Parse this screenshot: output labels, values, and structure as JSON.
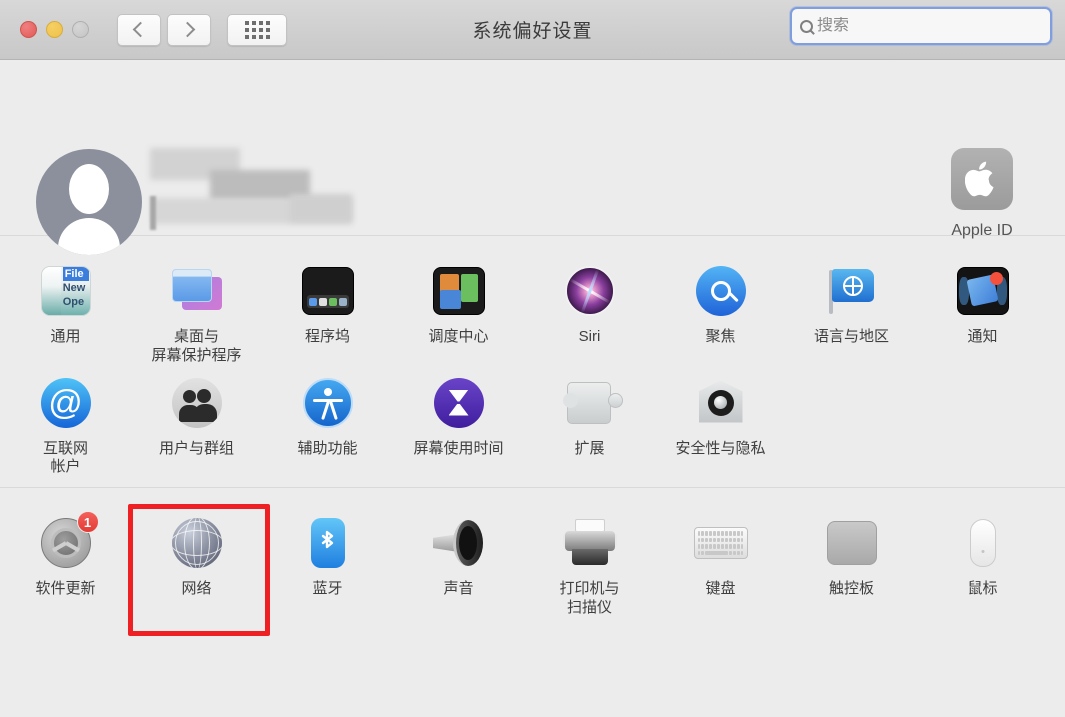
{
  "window": {
    "title": "系统偏好设置",
    "traffic_lights": [
      "close",
      "minimize",
      "zoom"
    ],
    "nav": {
      "back": "back-arrow",
      "forward": "forward-arrow",
      "grid": "show-all-grid"
    }
  },
  "search": {
    "placeholder": "搜索",
    "value": "",
    "icon": "search-icon",
    "focused": true
  },
  "account": {
    "avatar": "default-user-avatar",
    "name_redacted": true,
    "apple_id": {
      "label": "Apple ID",
      "icon": "apple-logo-icon"
    }
  },
  "sections": [
    {
      "id": "personal",
      "rows": [
        [
          {
            "label": "通用",
            "icon": "general-icon"
          },
          {
            "label": "桌面与\n屏幕保护程序",
            "icon": "desktop-screensaver-icon"
          },
          {
            "label": "程序坞",
            "icon": "dock-icon"
          },
          {
            "label": "调度中心",
            "icon": "mission-control-icon"
          },
          {
            "label": "Siri",
            "icon": "siri-icon"
          },
          {
            "label": "聚焦",
            "icon": "spotlight-icon"
          },
          {
            "label": "语言与地区",
            "icon": "language-region-icon"
          },
          {
            "label": "通知",
            "icon": "notifications-icon"
          }
        ],
        [
          {
            "label": "互联网\n帐户",
            "icon": "internet-accounts-icon"
          },
          {
            "label": "用户与群组",
            "icon": "users-groups-icon"
          },
          {
            "label": "辅助功能",
            "icon": "accessibility-icon"
          },
          {
            "label": "屏幕使用时间",
            "icon": "screen-time-icon"
          },
          {
            "label": "扩展",
            "icon": "extensions-icon"
          },
          {
            "label": "安全性与隐私",
            "icon": "security-privacy-icon"
          }
        ]
      ]
    },
    {
      "id": "hardware",
      "rows": [
        [
          {
            "label": "软件更新",
            "icon": "software-update-icon",
            "badge": "1"
          },
          {
            "label": "网络",
            "icon": "network-icon",
            "highlighted": true
          },
          {
            "label": "蓝牙",
            "icon": "bluetooth-icon"
          },
          {
            "label": "声音",
            "icon": "sound-icon"
          },
          {
            "label": "打印机与\n扫描仪",
            "icon": "printers-scanners-icon"
          },
          {
            "label": "键盘",
            "icon": "keyboard-icon"
          },
          {
            "label": "触控板",
            "icon": "trackpad-icon"
          },
          {
            "label": "鼠标",
            "icon": "mouse-icon"
          }
        ]
      ]
    }
  ],
  "colors": {
    "background": "#ececec",
    "titlebar": "#cfcfcf",
    "highlight": "#ef2024",
    "badge": "#e33b34",
    "focus_ring": "#7e9ee0"
  },
  "icon_art": {
    "general_file": "File",
    "general_new": "New",
    "general_open": "Ope",
    "at_symbol": "@"
  }
}
